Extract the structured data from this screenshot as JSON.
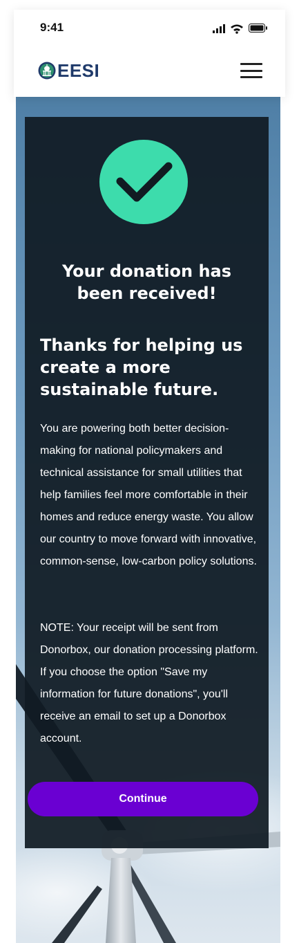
{
  "status_bar": {
    "time": "9:41"
  },
  "header": {
    "logo_text": "EESI",
    "menu_icon": "hamburger-menu-icon"
  },
  "confirmation": {
    "icon": "check-circle-icon",
    "icon_color": "#3ddcac",
    "headline": "Your donation has been received!",
    "subheadline": "Thanks for helping us create a more sustainable future.",
    "paragraph_1": "You are powering both better decision-making for national policymakers and technical assistance for small utilities that help families feel more comfortable in their homes and reduce energy waste. You allow our country to move forward with innovative, common-sense, low-carbon policy solutions.",
    "paragraph_2": "NOTE: Your receipt will be sent from Donorbox, our donation processing platform. If you choose the option \"Save my information for future donations\", you'll receive an email to set up a Donorbox account."
  },
  "actions": {
    "continue_label": "Continue",
    "continue_color": "#6a00d2"
  },
  "colors": {
    "card_background": "#101b24",
    "logo_color": "#1f3a6a"
  }
}
